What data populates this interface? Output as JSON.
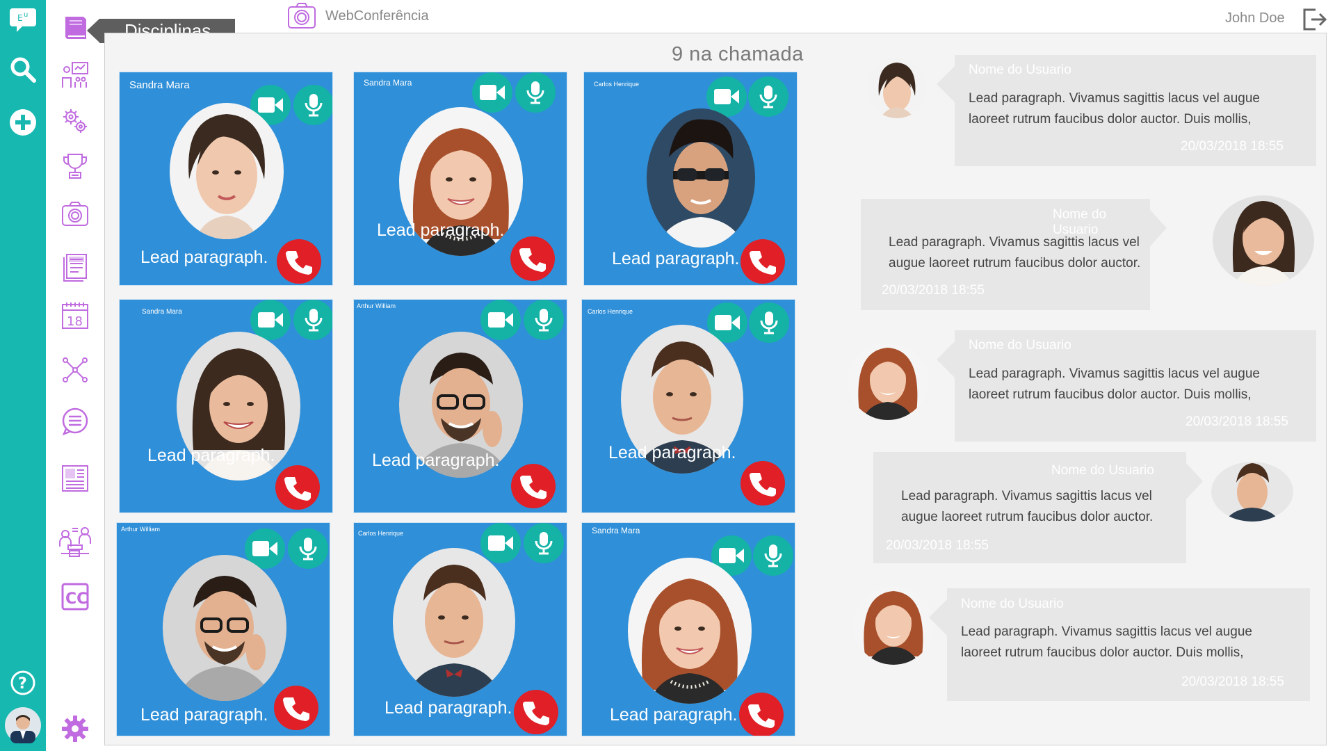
{
  "header": {
    "section_label": "Disciplinas",
    "app_title": "WebConferência",
    "user_name": "John Doe"
  },
  "call": {
    "count_label": "9 na chamada"
  },
  "tiles": [
    {
      "name": "Sandra Mara",
      "caption": "Lead paragraph."
    },
    {
      "name": "Sandra Mara",
      "caption": "Lead paragraph."
    },
    {
      "name": "Carlos Henrique",
      "caption": "Lead paragraph."
    },
    {
      "name": "Sandra Mara",
      "caption": "Lead paragraph."
    },
    {
      "name": "Arthur William",
      "caption": "Lead paragraph."
    },
    {
      "name": "Carlos Henrique",
      "caption": "Lead paragraph."
    },
    {
      "name": "Arthur William",
      "caption": "Lead paragraph."
    },
    {
      "name": "Carlos Henrique",
      "caption": "Lead paragraph."
    },
    {
      "name": "Sandra Mara",
      "caption": "Lead paragraph."
    }
  ],
  "chat": [
    {
      "user": "Nome do Usuario",
      "text": "Lead paragraph. Vivamus sagittis lacus vel augue laoreet rutrum faucibus dolor auctor. Duis mollis,",
      "time": "20/03/2018  18:55"
    },
    {
      "user": "Nome do Usuario",
      "text": "Lead paragraph. Vivamus sagittis lacus vel augue laoreet rutrum faucibus dolor auctor.",
      "time": "20/03/2018  18:55"
    },
    {
      "user": "Nome do Usuario",
      "text": "Lead paragraph. Vivamus sagittis lacus vel augue laoreet rutrum faucibus dolor auctor. Duis mollis,",
      "time": "20/03/2018  18:55"
    },
    {
      "user": "Nome do Usuario",
      "text": "Lead paragraph. Vivamus sagittis lacus vel augue laoreet rutrum faucibus dolor auctor.",
      "time": "20/03/2018  18:55"
    },
    {
      "user": "Nome do Usuario",
      "text": "Lead paragraph. Vivamus sagittis lacus vel augue laoreet rutrum faucibus dolor auctor. Duis mollis,",
      "time": "20/03/2018  18:55"
    }
  ],
  "rail": {
    "icons": [
      "chat-logo-icon",
      "search-icon",
      "add-icon",
      "help-icon",
      "user-avatar"
    ]
  },
  "sidebar": {
    "icons": [
      "book-icon",
      "presentation-icon",
      "gears-icon",
      "trophy-icon",
      "camera-icon",
      "documents-icon",
      "calendar-icon",
      "network-icon",
      "chat-list-icon",
      "newspaper-icon",
      "meeting-icon",
      "closed-caption-icon",
      "settings-icon"
    ],
    "calendar_day": "18",
    "cc_label": "CC"
  },
  "colors": {
    "rail": "#16b8b0",
    "tile": "#2f8fd8",
    "media_button": "#14b3a6",
    "hangup": "#e11f26",
    "accent_purple": "#c06be0",
    "tab": "#5e5e5e"
  }
}
